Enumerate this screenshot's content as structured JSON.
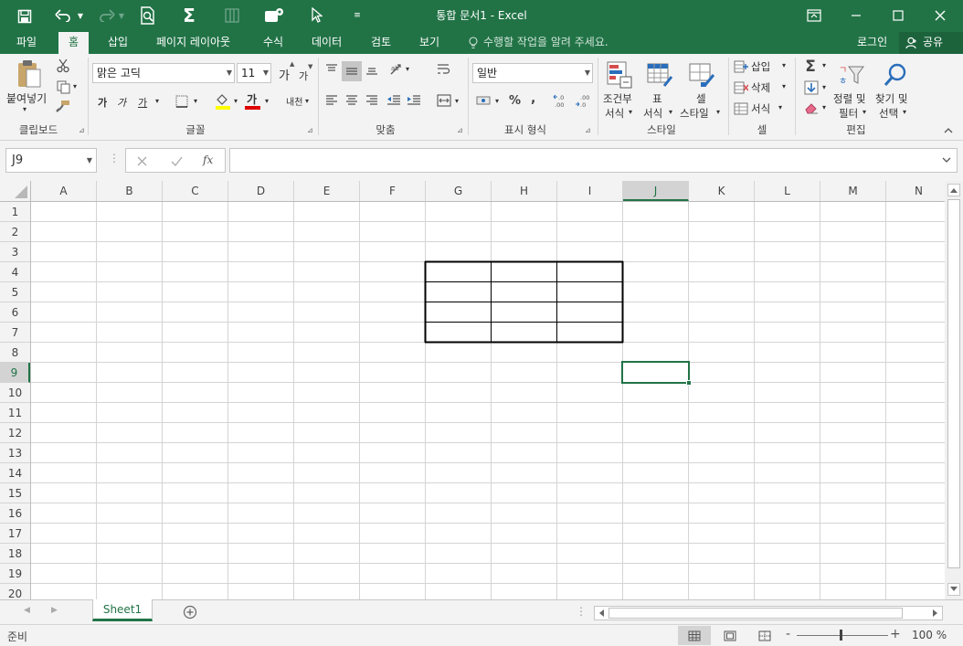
{
  "window": {
    "title": "통합 문서1 - Excel"
  },
  "tabs": [
    {
      "label": "파일"
    },
    {
      "label": "홈"
    },
    {
      "label": "삽입"
    },
    {
      "label": "페이지 레이아웃"
    },
    {
      "label": "수식"
    },
    {
      "label": "데이터"
    },
    {
      "label": "검토"
    },
    {
      "label": "보기"
    }
  ],
  "active_tab": "홈",
  "tell_me": "수행할 작업을 알려 주세요.",
  "account": {
    "login": "로그인",
    "share": "공유"
  },
  "ribbon": {
    "clipboard": {
      "group": "클립보드",
      "paste": "붙여넣기"
    },
    "font": {
      "group": "글꼴",
      "name": "맑은 고딕",
      "size": "11",
      "grow": "가",
      "shrink": "가",
      "bold": "가",
      "italic": "가",
      "underline": "가",
      "font_color": "가",
      "phonetic": "내천"
    },
    "align": {
      "group": "맞춤"
    },
    "number": {
      "group": "표시 형식",
      "format": "일반",
      "percent": "%",
      "comma": ","
    },
    "styles": {
      "group": "스타일",
      "conditional_1": "조건부",
      "conditional_2": "서식",
      "table_1": "표",
      "table_2": "서식",
      "cell_1": "셀",
      "cell_2": "스타일"
    },
    "cells": {
      "group": "셀",
      "insert": "삽입",
      "delete": "삭제",
      "format": "서식"
    },
    "editing": {
      "group": "편집",
      "sort_1": "정렬 및",
      "sort_2": "필터",
      "find_1": "찾기 및",
      "find_2": "선택"
    }
  },
  "formula_bar": {
    "name_box": "J9",
    "fx": "fx",
    "value": ""
  },
  "grid": {
    "columns": [
      "A",
      "B",
      "C",
      "D",
      "E",
      "F",
      "G",
      "H",
      "I",
      "J",
      "K",
      "L",
      "M",
      "N"
    ],
    "rows": [
      "1",
      "2",
      "3",
      "4",
      "5",
      "6",
      "7",
      "8",
      "9",
      "10",
      "11",
      "12",
      "13",
      "14",
      "15",
      "16",
      "17",
      "18",
      "19",
      "20"
    ],
    "active_cell": "J9",
    "bordered_range": "G4:I7"
  },
  "sheets": [
    {
      "name": "Sheet1"
    }
  ],
  "status": {
    "ready": "준비",
    "zoom": "100 %"
  },
  "colors": {
    "brand": "#217346",
    "ribbon_bg": "#f3f3f3",
    "grid_line": "#d4d4d4",
    "font_color_bar": "#e00000",
    "fill_color_bar": "#ffff00"
  }
}
